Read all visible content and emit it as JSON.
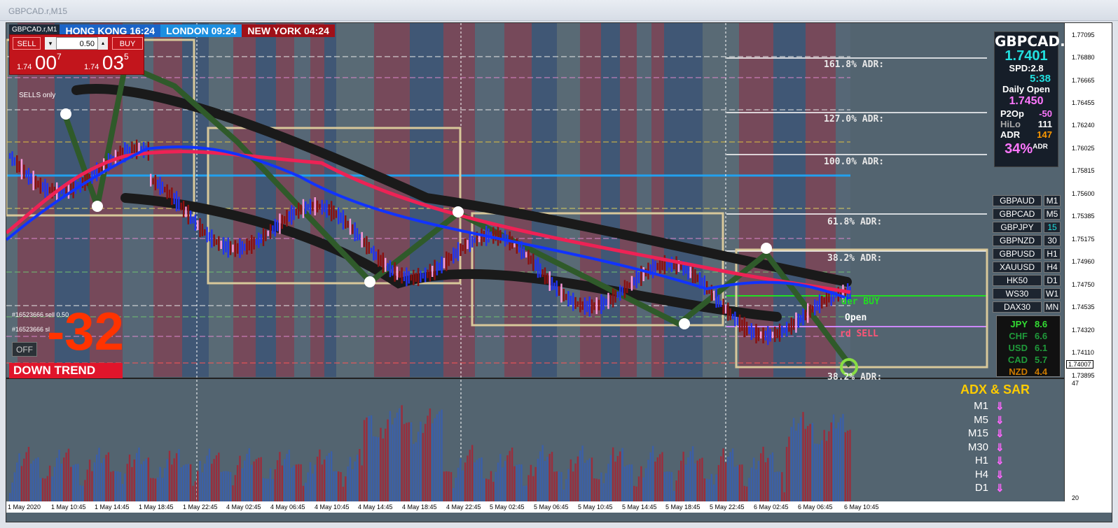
{
  "window": {
    "title": "GBPCAD.r,M15"
  },
  "chart": {
    "symbol_label": "GBPCAD.r,M1",
    "sessions": [
      {
        "label": "HONG KONG 16:24",
        "color": "#1a64c8"
      },
      {
        "label": "LONDON  09:24",
        "color": "#1c8fe0"
      },
      {
        "label": "NEW YORK  04:24",
        "color": "#a01018"
      }
    ],
    "trade_panel": {
      "sell_label": "SELL",
      "buy_label": "BUY",
      "lot": "0.50",
      "sell_price": {
        "prefix": "1.74",
        "big": "00",
        "sup": "7"
      },
      "buy_price": {
        "prefix": "1.74",
        "big": "03",
        "sup": "5"
      }
    },
    "sells_only_label": "SELLS only",
    "order_labels": [
      "#16523666 sell 0.50",
      "#16523666 sl"
    ],
    "off_label": "OFF",
    "pips_value": "-32",
    "trend_label": "DOWN TREND",
    "adr_labels": [
      {
        "text": "161.8% ADR:"
      },
      {
        "text": "127.0% ADR:"
      },
      {
        "text": "100.0% ADR:"
      },
      {
        "text": "61.8% ADR:"
      },
      {
        "text": "38.2% ADR:"
      },
      {
        "text": "38.2% ADR:"
      }
    ],
    "level_labels": {
      "buy": "der BUY",
      "open": "Open",
      "sell": "rd SELL"
    },
    "price_axis": [
      "1.77095",
      "1.76880",
      "1.76665",
      "1.76455",
      "1.76240",
      "1.76025",
      "1.75815",
      "1.75600",
      "1.75385",
      "1.75175",
      "1.74960",
      "1.74750",
      "1.74535",
      "1.74320",
      "1.74110",
      "1.73895"
    ],
    "current_price": "1.74007",
    "indicator_axis": {
      "top": "47",
      "bottom": "20"
    },
    "time_axis": [
      "1 May 2020",
      "1 May 10:45",
      "1 May 14:45",
      "1 May 18:45",
      "1 May 22:45",
      "4 May 02:45",
      "4 May 06:45",
      "4 May 10:45",
      "4 May 14:45",
      "4 May 18:45",
      "4 May 22:45",
      "5 May 02:45",
      "5 May 06:45",
      "5 May 10:45",
      "5 May 14:45",
      "5 May 18:45",
      "5 May 22:45",
      "6 May 02:45",
      "6 May 06:45",
      "6 May 10:45"
    ]
  },
  "info_panel": {
    "symbol": "GBPCAD.",
    "price": "1.7401",
    "spread_label": "SPD:",
    "spread": "2.8",
    "timer": "5:38",
    "daily_open_label": "Daily Open",
    "daily_open": "1.7450",
    "rows": [
      {
        "label": "P2Op",
        "value": "-50",
        "color": "#ff77ff"
      },
      {
        "label": "HiLo",
        "value": "111",
        "color": "#ffffff"
      },
      {
        "label": "ADR",
        "value": "147",
        "color": "#ff9900"
      }
    ],
    "adr_percent": "34%",
    "adr_suffix": "ADR"
  },
  "symbols": [
    {
      "symbol": "GBPAUD",
      "tf": "M1"
    },
    {
      "symbol": "GBPCAD",
      "tf": "M5"
    },
    {
      "symbol": "GBPJPY",
      "tf": "15"
    },
    {
      "symbol": "GBPNZD",
      "tf": "30"
    },
    {
      "symbol": "GBPUSD",
      "tf": "H1"
    },
    {
      "symbol": "XAUUSD",
      "tf": "H4"
    },
    {
      "symbol": "HK50",
      "tf": "D1"
    },
    {
      "symbol": "WS30",
      "tf": "W1"
    },
    {
      "symbol": "DAX30",
      "tf": "MN"
    }
  ],
  "currency_strength": [
    {
      "ccy": "JPY",
      "value": "8.6",
      "color": "#33dd33"
    },
    {
      "ccy": "CHF",
      "value": "6.6",
      "color": "#1f9a3a"
    },
    {
      "ccy": "USD",
      "value": "6.1",
      "color": "#1f9a3a"
    },
    {
      "ccy": "CAD",
      "value": "5.7",
      "color": "#1f9a3a"
    },
    {
      "ccy": "NZD",
      "value": "4.4",
      "color": "#cc7a00"
    }
  ],
  "adx_sar": {
    "title": "ADX & SAR",
    "rows": [
      {
        "tf": "M1",
        "arrow": "⇓"
      },
      {
        "tf": "M5",
        "arrow": "⇓"
      },
      {
        "tf": "M15",
        "arrow": "⇓"
      },
      {
        "tf": "M30",
        "arrow": "⇓"
      },
      {
        "tf": "H1",
        "arrow": "⇓"
      },
      {
        "tf": "H4",
        "arrow": "⇓"
      },
      {
        "tf": "D1",
        "arrow": "⇓"
      }
    ]
  }
}
